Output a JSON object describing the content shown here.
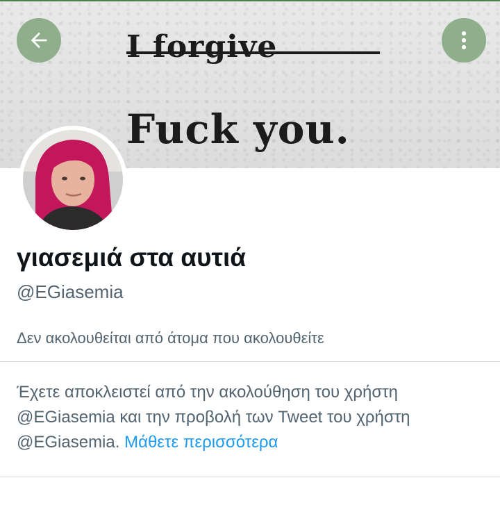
{
  "banner": {
    "line1": "I forgive",
    "line2": "Fuck you."
  },
  "header": {
    "back_icon": "arrow-left-icon",
    "more_icon": "more-vertical-icon"
  },
  "profile": {
    "display_name": "γιασεμιά στα αυτιά",
    "handle": "@EGiasemia",
    "follow_note": "Δεν ακολουθείται από άτομα που ακολουθείτε"
  },
  "blocked_notice": {
    "text_before": "Έχετε αποκλειστεί από την ακολούθηση του χρήστη @EGiasemia και την προβολή των Tweet του χρήστη @EGiasemia. ",
    "learn_more": "Μάθετε περισσότερα"
  },
  "colors": {
    "accent": "#1d9bf0",
    "button_bg": "#8fae8b",
    "secondary_text": "#536471"
  }
}
